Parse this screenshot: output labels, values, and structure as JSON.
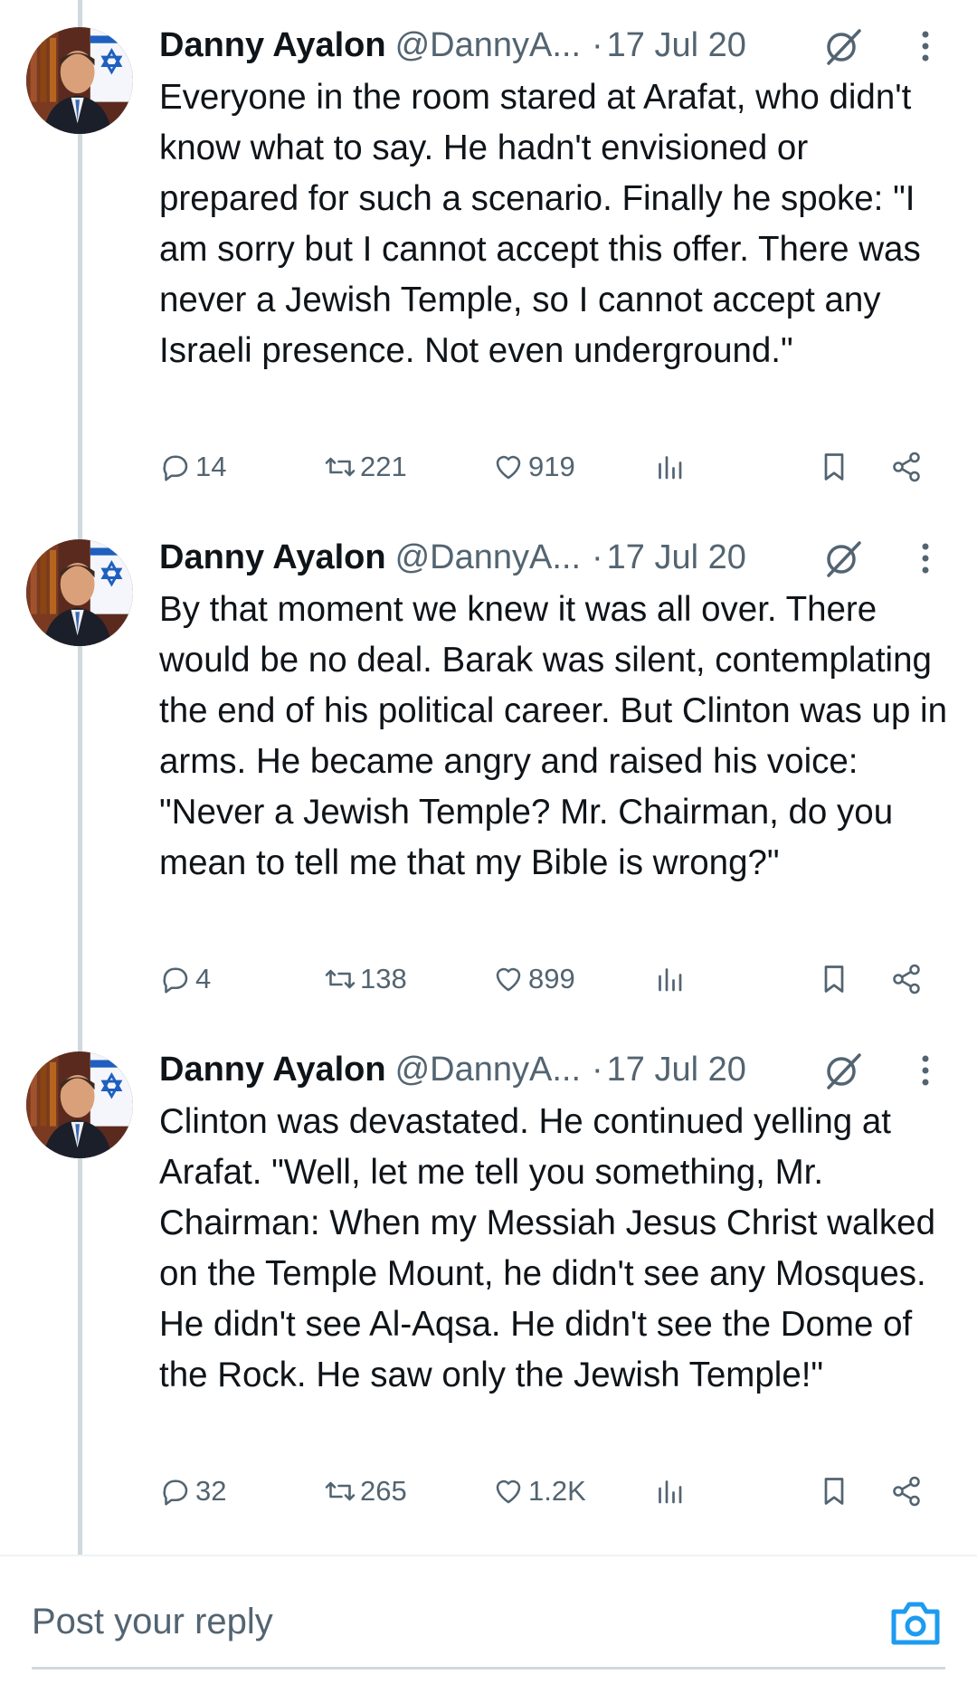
{
  "tweets": [
    {
      "name": "Danny Ayalon",
      "handle": "@DannyA...",
      "separator": "·",
      "date": "17 Jul 20",
      "text": "Everyone in the room stared at Arafat, who didn't know what to say. He hadn't envisioned or prepared for such a scenario. Finally he spoke: \"I am sorry but I cannot accept this offer. There was never a Jewish Temple, so I cannot accept any Israeli presence. Not even underground.\"",
      "replies": "14",
      "reposts": "221",
      "likes": "919"
    },
    {
      "name": "Danny Ayalon",
      "handle": "@DannyA...",
      "separator": "·",
      "date": "17 Jul 20",
      "text": "By that moment we knew it was all over. There would be no deal. Barak was silent, contemplating the end of his political career. But Clinton was up in arms. He became angry and raised his voice: \"Never a Jewish Temple? Mr. Chairman, do you mean to tell me that my Bible is wrong?\"",
      "replies": "4",
      "reposts": "138",
      "likes": "899"
    },
    {
      "name": "Danny Ayalon",
      "handle": "@DannyA...",
      "separator": "·",
      "date": "17 Jul 20",
      "text": "Clinton was devastated. He continued yelling at Arafat. \"Well, let me tell you something, Mr. Chairman: When my Messiah Jesus Christ walked on the Temple Mount, he didn't see any Mosques. He didn't see Al-Aqsa. He didn't see the Dome of the Rock. He saw only the Jewish Temple!\"",
      "replies": "32",
      "reposts": "265",
      "likes": "1.2K"
    }
  ],
  "reply_bar": {
    "placeholder": "Post your reply",
    "camera_icon": "camera-icon"
  },
  "colors": {
    "text": "#0f1419",
    "secondary": "#536471",
    "accent": "#1d9bf0",
    "thread_line": "#cfd9de"
  }
}
